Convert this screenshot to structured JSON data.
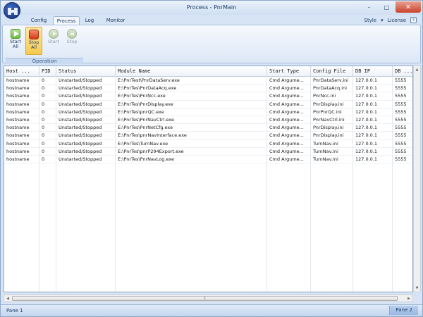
{
  "window": {
    "title": "Process - PnrMain"
  },
  "window_controls": {
    "minimize": "–",
    "maximize": "□",
    "close": "✕"
  },
  "ribbon_tabs": [
    {
      "label": "Config"
    },
    {
      "label": "Process"
    },
    {
      "label": "Log"
    },
    {
      "label": "Monitor"
    }
  ],
  "right_links": {
    "style": "Style",
    "license": "License",
    "help_glyph": "?"
  },
  "operation_group": {
    "label": "Operation",
    "buttons": [
      {
        "label": "Start All",
        "icon": "start-all-icon",
        "enabled": true
      },
      {
        "label": "Stop All",
        "icon": "stop-all-icon",
        "enabled": true,
        "active": true
      },
      {
        "label": "Start",
        "icon": "start-icon",
        "enabled": false
      },
      {
        "label": "Stop",
        "icon": "stop-icon",
        "enabled": false
      }
    ]
  },
  "table": {
    "columns": [
      "Host ...",
      "PID",
      "Status",
      "Module Name",
      "Start Type",
      "Config File",
      "DB IP",
      "DB ..."
    ],
    "rows": [
      [
        "hostname",
        "0",
        "Unstarted/Stopped",
        "E:\\PnrTest\\PnrDataServ.exe",
        "Cmd Argume...",
        "PnrDataServ.ini",
        "127.0.0.1",
        "5555"
      ],
      [
        "hostname",
        "0",
        "Unstarted/Stopped",
        "E:\\PnrTes\\PnrDataAcq.exe",
        "Cmd Argume...",
        "PnrDataAcq.ini",
        "127.0.0.1",
        "5555"
      ],
      [
        "hostname",
        "0",
        "Unstarted/Stopped",
        "E:\\PnrTes\\PnrNcc.exe",
        "Cmd Argume...",
        "PnrNcc.ini",
        "127.0.0.1",
        "5555"
      ],
      [
        "hostname",
        "0",
        "Unstarted/Stopped",
        "E:\\PnrTes\\PnrDisplay.exe",
        "Cmd Argume...",
        "PnrDisplay.ini",
        "127.0.0.1",
        "5555"
      ],
      [
        "hostname",
        "0",
        "Unstarted/Stopped",
        "E:\\PnrTes\\pnrQC.exe",
        "Cmd Argume...",
        "PnrPnrQC.ini",
        "127.0.0.1",
        "5555"
      ],
      [
        "hostname",
        "0",
        "Unstarted/Stopped",
        "E:\\PnrTes\\PnrNavCtrl.exe",
        "Cmd Argume...",
        "PnrNavCtrl.ini",
        "127.0.0.1",
        "5555"
      ],
      [
        "hostname",
        "0",
        "Unstarted/Stopped",
        "E:\\PnrTes\\PnrNetCfg.exe",
        "Cmd Argume...",
        "PnrDisplay.ini",
        "127.0.0.1",
        "5555"
      ],
      [
        "hostname",
        "0",
        "Unstarted/Stopped",
        "E:\\PnrTes\\pnrNavInterface.exe",
        "Cmd Argume...",
        "PnrDisplay.ini",
        "127.0.0.1",
        "5555"
      ],
      [
        "hostname",
        "0",
        "Unstarted/Stopped",
        "E:\\PnrTes\\TurnNav.exe",
        "Cmd Argume...",
        "TurnNav.ini",
        "127.0.0.1",
        "5555"
      ],
      [
        "hostname",
        "0",
        "Unstarted/Stopped",
        "E:\\PnrTes\\pnrP294Export.exe",
        "Cmd Argume...",
        "TurnNav.ini",
        "127.0.0.1",
        "5555"
      ],
      [
        "hostname",
        "0",
        "Unstarted/Stopped",
        "E:\\PnrTes\\PnrNavLog.exe",
        "Cmd Argume...",
        "TurnNav.ini",
        "127.0.0.1",
        "5555"
      ]
    ]
  },
  "statusbar": {
    "pane1": "Pane 1",
    "pane2": "Pane 2"
  },
  "colors": {
    "accent": "#1f3b63",
    "ribbon": "#dce8f6",
    "active_button": "#f7c94f",
    "start_green": "#6cbf3b",
    "stop_red": "#d53b18"
  }
}
